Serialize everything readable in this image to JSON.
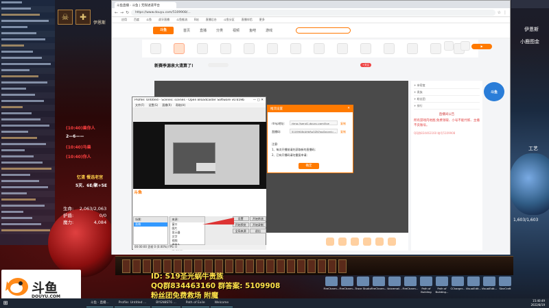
{
  "game": {
    "top_text": "伊恩斯",
    "stats": [
      {
        "label": "生命:",
        "value": "2,063/2,063"
      },
      {
        "label": "护盾:",
        "value": "0/0"
      },
      {
        "label": "魔力:",
        "value": "4,084"
      }
    ],
    "float_lines": [
      {
        "text": "(10:40)兽你人",
        "color": "#ff4040"
      },
      {
        "text": "2—6——",
        "color": "#ffffff"
      },
      {
        "text": "(10:40)马兽",
        "color": "#ff4040"
      },
      {
        "text": "(10:40)你人",
        "color": "#ff4040"
      },
      {
        "text": "忆清 餐选老宫",
        "color": "#ffd04a"
      },
      {
        "text": "5灭、6E/聚+5E",
        "color": "#ffffff"
      }
    ],
    "right_labels": [
      "伊恩斯",
      "小鹿图金",
      "工艺",
      "1,603/1,603"
    ]
  },
  "browser": {
    "tab_title": "斗鱼直播 - 斗鱼 | 无限进道平台",
    "url": "https://www.douyu.com/5109908/...",
    "bookmarks": [
      "应用",
      "百度",
      "斗鱼",
      "虎牙直播",
      "斗鱼推流",
      "B站",
      "直播后台",
      "斗鱼分区",
      "直播伴侣",
      "更多"
    ]
  },
  "douyu": {
    "logo": "斗鱼",
    "nav": [
      "首页",
      "直播",
      "分类",
      "视频",
      "鱼吧",
      "游戏"
    ],
    "room_title": "新赛季源泉大清算了!",
    "follow_btn": "+关注",
    "badge": "斗鱼",
    "side_rows": [
      "+ 亲密度",
      "+ 贵族",
      "+ 粉丝团",
      "+ 排行"
    ],
    "notice_title": "直播间公告",
    "notice_text": "所有游戏内地图,免费领取、小号不能代练、主播不卖账号。",
    "notice_text2": "QQ群834463160 暗号5109908"
  },
  "obs": {
    "title": "Profile: Untitled - Scenes: scenes - Open Broadcaster Software v0.659b",
    "menu": [
      "文件(F)",
      "设置(S)",
      "直播(R)",
      "帮助(H)"
    ],
    "scenes_header": "场景:",
    "scenes": [
      "直播"
    ],
    "sources_header": "来源:",
    "sources": [
      "窗口",
      "图片",
      "显示器",
      "文字",
      "视频",
      "摄像头",
      "游戏录像"
    ],
    "buttons": [
      "设置",
      "开始串流",
      "开始预览",
      "开始录制",
      "全局来源",
      "退出"
    ],
    "status": "00:00:00 丢帧 0 (0.00%)  FPS: 0"
  },
  "dialog": {
    "title": "推流设置",
    "labels": [
      "rtmp地址:",
      "直播码:"
    ],
    "rtmp_value": "rtmp://send1.douyu.com/live",
    "code_value": "5109908rAHkRp3ZN?wsSecret=...",
    "copy_label": "复制",
    "notes": [
      "注意:",
      "1、每次开播前请先获取新的直播码;",
      "2、已有开播码请勿重复申请;"
    ],
    "submit": "确定"
  },
  "overlay": {
    "line1": "ID: S19圣光蜗牛贵族",
    "line2": "QQ群834463160 群答案: 5109908",
    "line3": "粉丝团免费救场 附魔"
  },
  "watermark": {
    "text": "斗鱼",
    "sub": "DOUYU.COM"
  },
  "taskbar": {
    "items": [
      "斗鱼 - 直播...",
      "Profile: Untitled ...",
      "BYGN8ST6 ...",
      "Path of Exile",
      "Welcome"
    ],
    "time": "15:40:49",
    "date": "2022/8/19"
  },
  "desktop_icons": [
    "FireCharm...",
    "FireCharm...",
    "Trace Studio",
    "FireCharm...",
    "Voicemail...",
    "FireCharm...",
    "Path of Building",
    "Path of Building...",
    "CCharger...",
    "VisualEdit...",
    "VisualEdit...",
    "StarCraft"
  ]
}
